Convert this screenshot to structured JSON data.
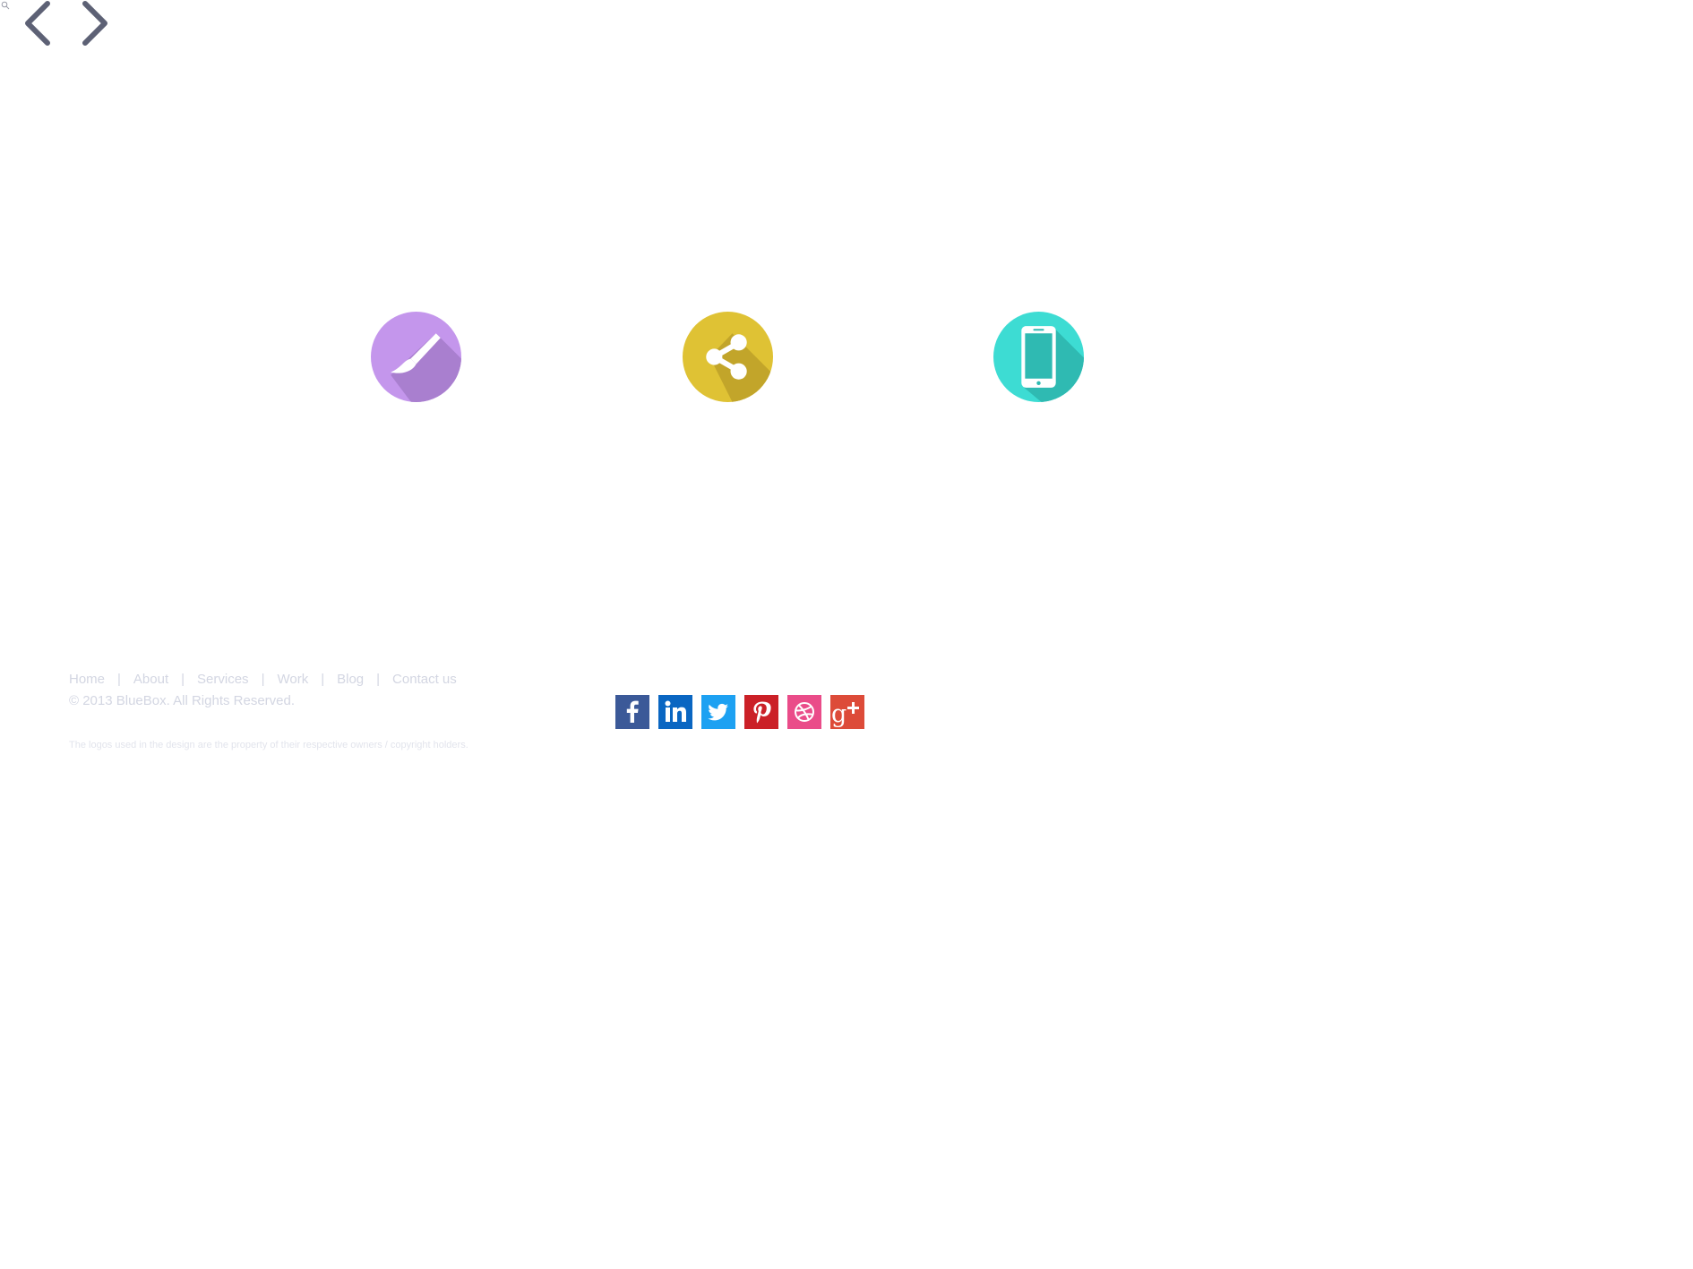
{
  "icons": {
    "search": "search-icon",
    "prev": "chevron-left-icon",
    "next": "chevron-right-icon"
  },
  "services": [
    {
      "icon": "paintbrush-icon",
      "color": "#c496ec",
      "shadow": "#a97fcf"
    },
    {
      "icon": "share-icon",
      "color": "#dfc234",
      "shadow": "#c2a52a"
    },
    {
      "icon": "smartphone-icon",
      "color": "#3ddcd3",
      "shadow": "#2fbab2"
    }
  ],
  "footer": {
    "nav": [
      {
        "label": "Home"
      },
      {
        "label": "About"
      },
      {
        "label": "Services"
      },
      {
        "label": "Work"
      },
      {
        "label": "Blog"
      },
      {
        "label": "Contact us"
      }
    ],
    "separator": "|",
    "copyright": "© 2013 BlueBox.  All Rights Reserved.",
    "disclaimer": "The logos used in the design are the property of their respective owners / copyright holders."
  },
  "social": [
    {
      "name": "facebook",
      "glyph": "f",
      "color": "#3b5998"
    },
    {
      "name": "linkedin",
      "glyph": "in",
      "color": "#0a66c2"
    },
    {
      "name": "twitter",
      "glyph": "twitter-bird",
      "color": "#1da1f2"
    },
    {
      "name": "pinterest",
      "glyph": "p",
      "color": "#cb2027"
    },
    {
      "name": "dribbble",
      "glyph": "dribbble-ball",
      "color": "#ea4c89"
    },
    {
      "name": "google-plus",
      "glyph": "g+",
      "color": "#dd4b39"
    }
  ],
  "colors": {
    "arrow": "#5d6175",
    "footer_text": "#d3d6e2"
  }
}
